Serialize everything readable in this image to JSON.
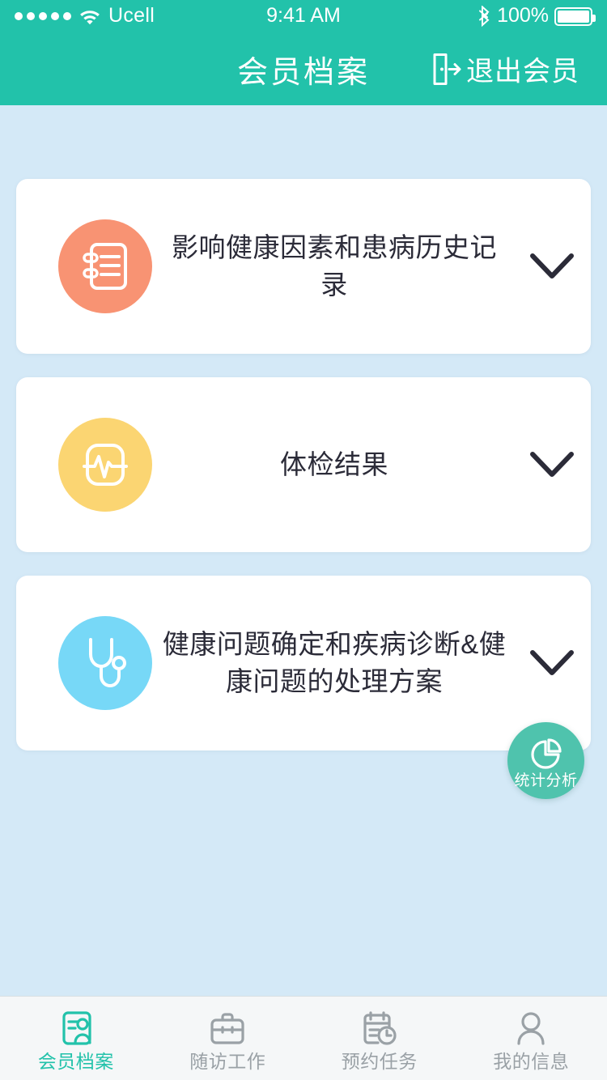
{
  "status_bar": {
    "signal_dots": 5,
    "wifi_icon": "wifi-icon",
    "carrier": "Ucell",
    "time": "9:41 AM",
    "bluetooth_icon": "bluetooth-icon",
    "battery_percent": "100%",
    "battery_icon": "battery-full-icon"
  },
  "header": {
    "title": "会员档案",
    "action_label": "退出会员",
    "action_icon": "logout-door-icon",
    "background": "#22c2aa",
    "text_color": "#ffffff"
  },
  "page": {
    "background": "#d4e9f7"
  },
  "cards": [
    {
      "title": "影响健康因素和患病历史记录",
      "icon": "notebook-record-icon",
      "icon_color": "#f89373",
      "chevron": "chevron-down-icon",
      "expanded": false
    },
    {
      "title": "体检结果",
      "icon": "health-monitor-ecg-icon",
      "icon_color": "#fbd572",
      "chevron": "chevron-down-icon",
      "expanded": false
    },
    {
      "title": "健康问题确定和疾病诊断&健康问题的处理方案",
      "icon": "stethoscope-icon",
      "icon_color": "#77d8f7",
      "chevron": "chevron-down-icon",
      "expanded": false
    }
  ],
  "fab": {
    "label": "统计分析",
    "icon": "pie-chart-icon",
    "color": "#4fc3ad"
  },
  "tabbar": {
    "active_color": "#22c2aa",
    "inactive_color": "#9aa1a6",
    "items": [
      {
        "label": "会员档案",
        "icon": "member-card-icon",
        "active": true
      },
      {
        "label": "随访工作",
        "icon": "briefcase-icon",
        "active": false
      },
      {
        "label": "预约任务",
        "icon": "calendar-clock-icon",
        "active": false
      },
      {
        "label": "我的信息",
        "icon": "person-icon",
        "active": false
      }
    ]
  }
}
